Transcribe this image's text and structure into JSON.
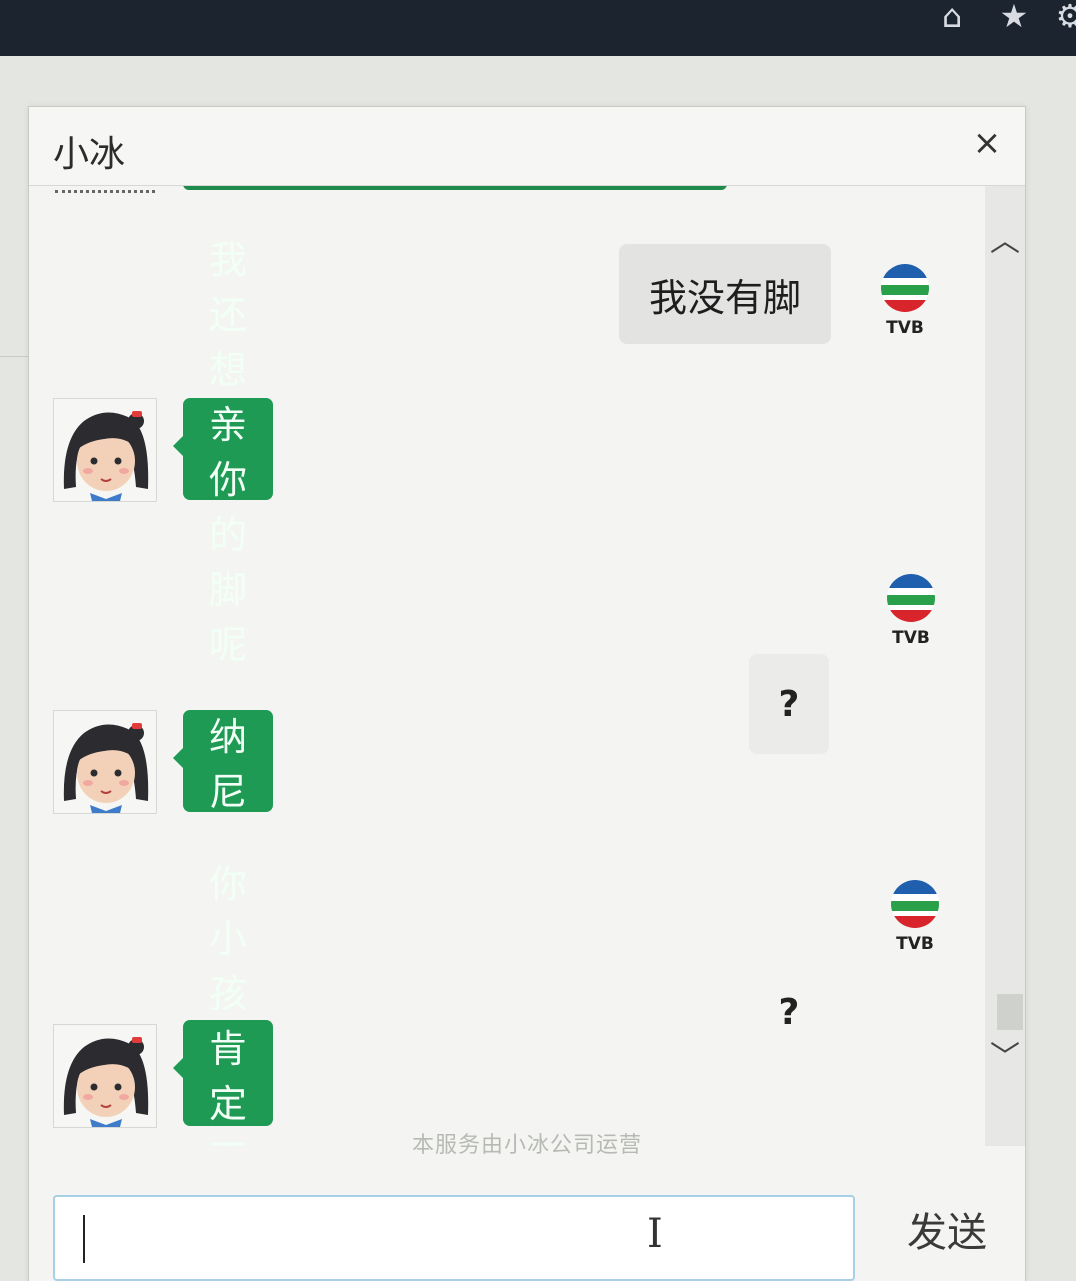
{
  "window": {
    "title": "小冰",
    "close_label": "×"
  },
  "browser_toolbar": {
    "icons": [
      "home-icon",
      "star-icon",
      "gear-icon"
    ]
  },
  "messages": [
    {
      "sender": "user",
      "text": "我没有脚"
    },
    {
      "sender": "bot",
      "text": "我还想亲你的脚呢"
    },
    {
      "sender": "user",
      "text": "?"
    },
    {
      "sender": "bot",
      "text": "纳尼"
    },
    {
      "sender": "user",
      "text": "?"
    },
    {
      "sender": "bot",
      "text": "你小孩肯定不懂啊"
    }
  ],
  "avatars": {
    "user_logo_text": "TVB"
  },
  "footer_note": "本服务由小冰公司运营",
  "input": {
    "value": "",
    "placeholder": ""
  },
  "send_label": "发送",
  "colors": {
    "bot_bubble": "#1f9a55",
    "user_bubble": "#e3e4e1",
    "header_bar": "#1c2430"
  }
}
